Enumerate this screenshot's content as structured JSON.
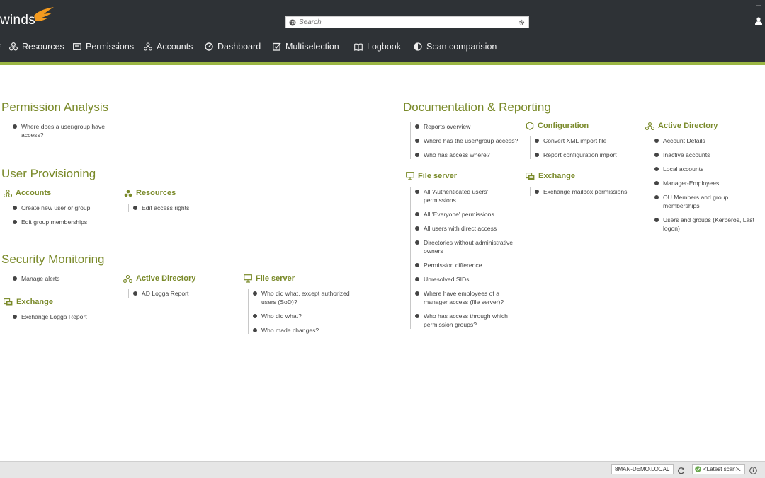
{
  "app": {
    "logo_text": "winds",
    "search_placeholder": "Search"
  },
  "nav": [
    {
      "label": "Resources",
      "icon": "resources-icon"
    },
    {
      "label": "Permissions",
      "icon": "permissions-icon"
    },
    {
      "label": "Accounts",
      "icon": "accounts-icon"
    },
    {
      "label": "Dashboard",
      "icon": "dashboard-icon"
    },
    {
      "label": "Multiselection",
      "icon": "multiselection-icon"
    },
    {
      "label": "Logbook",
      "icon": "logbook-icon"
    },
    {
      "label": "Scan comparision",
      "icon": "scan-comparison-icon"
    }
  ],
  "colors": {
    "accent": "#9bb643",
    "heading": "#7a8a2a",
    "topbar": "#2e3236"
  },
  "permission_analysis": {
    "title": "Permission Analysis",
    "items": [
      "Where does a user/group have access?"
    ]
  },
  "user_provisioning": {
    "title": "User Provisioning",
    "accounts": {
      "title": "Accounts",
      "items": [
        "Create new user or group",
        "Edit group memberships"
      ]
    },
    "resources": {
      "title": "Resources",
      "items": [
        "Edit access rights"
      ]
    }
  },
  "security_monitoring": {
    "title": "Security Monitoring",
    "general": {
      "items": [
        "Manage alerts"
      ]
    },
    "exchange": {
      "title": "Exchange",
      "items": [
        "Exchange Logga Report"
      ]
    },
    "active_directory": {
      "title": "Active Directory",
      "items": [
        "AD Logga Report"
      ]
    },
    "file_server": {
      "title": "File server",
      "items": [
        "Who did what, except authorized users (SoD)?",
        "Who did what?",
        "Who made changes?"
      ]
    }
  },
  "documentation": {
    "title": "Documentation & Reporting",
    "general": {
      "items": [
        "Reports overview",
        "Where has the user/group access?",
        "Who has access where?"
      ]
    },
    "configuration": {
      "title": "Configuration",
      "items": [
        "Convert XML import file",
        "Report configuration import"
      ]
    },
    "active_directory": {
      "title": "Active Directory",
      "items": [
        "Account Details",
        "Inactive accounts",
        "Local accounts",
        "Manager-Employees",
        "OU Members and group memberships",
        "Users and groups (Kerberos, Last logon)"
      ]
    },
    "file_server": {
      "title": "File server",
      "items": [
        "All 'Authenticated users' permissions",
        "All 'Everyone' permissions",
        "All users with direct access",
        "Directories without administrative owners",
        "Permission difference",
        "Unresolved SIDs",
        "Where have employees of a manager access (file server)?",
        "Who has access through which permission groups?"
      ]
    },
    "exchange": {
      "title": "Exchange",
      "items": [
        "Exchange mailbox permissions"
      ]
    }
  },
  "status": {
    "domain": "8MAN-DEMO.LOCAL",
    "scan": "<Latest scan>"
  }
}
